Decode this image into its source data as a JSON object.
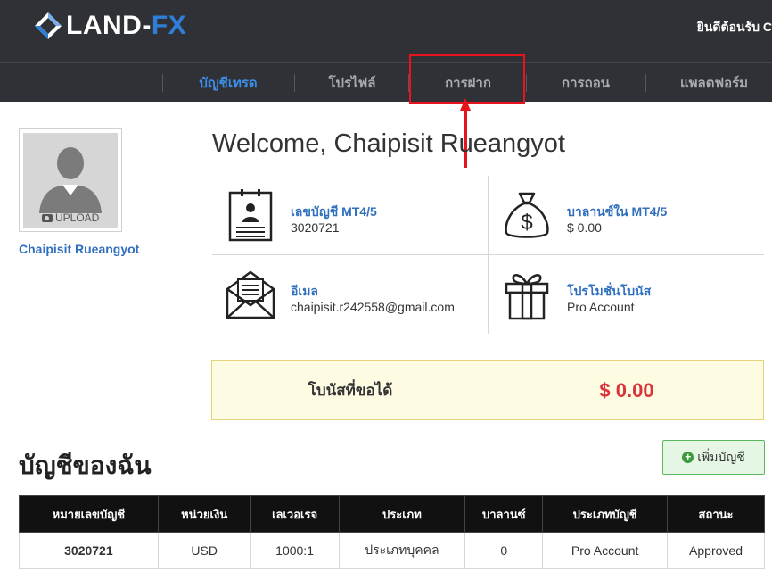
{
  "header": {
    "brand_primary": "LAND-",
    "brand_accent": "FX",
    "welcome_text": "ยินดีต้อนรับ C"
  },
  "nav": {
    "items": [
      {
        "label": "บัญชีเทรด",
        "active": true
      },
      {
        "label": "โปรไฟล์",
        "active": false
      },
      {
        "label": "การฝาก",
        "active": false
      },
      {
        "label": "การถอน",
        "active": false
      },
      {
        "label": "แพลตฟอร์ม",
        "active": false
      }
    ]
  },
  "profile": {
    "upload_label": "UPLOAD",
    "name": "Chaipisit Rueangyot"
  },
  "main": {
    "welcome_title": "Welcome, Chaipisit Rueangyot",
    "info": [
      {
        "label": "เลขบัญชี MT4/5",
        "value": "3020721",
        "icon": "id-document-icon"
      },
      {
        "label": "บาลานซ์ใน MT4/5",
        "value": "$ 0.00",
        "icon": "money-bag-icon"
      },
      {
        "label": "อีเมล",
        "value": "chaipisit.r242558@gmail.com",
        "icon": "envelope-icon"
      },
      {
        "label": "โปรโมชั่นโบนัส",
        "value": "Pro Account",
        "icon": "gift-box-icon"
      }
    ],
    "bonus": {
      "label": "โบนัสที่ขอได้",
      "value": "$ 0.00"
    }
  },
  "accounts": {
    "title": "บัญชีของฉัน",
    "add_button": "เพิ่มบัญชี",
    "columns": [
      "หมายเลขบัญชี",
      "หน่วยเงิน",
      "เลเวอเรจ",
      "ประเภท",
      "บาลานซ์",
      "ประเภทบัญชี",
      "สถานะ"
    ],
    "rows": [
      [
        "3020721",
        "USD",
        "1000:1",
        "ประเภทบุคคล",
        "0",
        "Pro Account",
        "Approved"
      ]
    ]
  },
  "colors": {
    "header_bg": "#2f3136",
    "accent_blue": "#3d8ee8",
    "link_blue": "#2f6fbe",
    "annotation_red": "#e8141b",
    "bonus_red": "#d9363b"
  }
}
